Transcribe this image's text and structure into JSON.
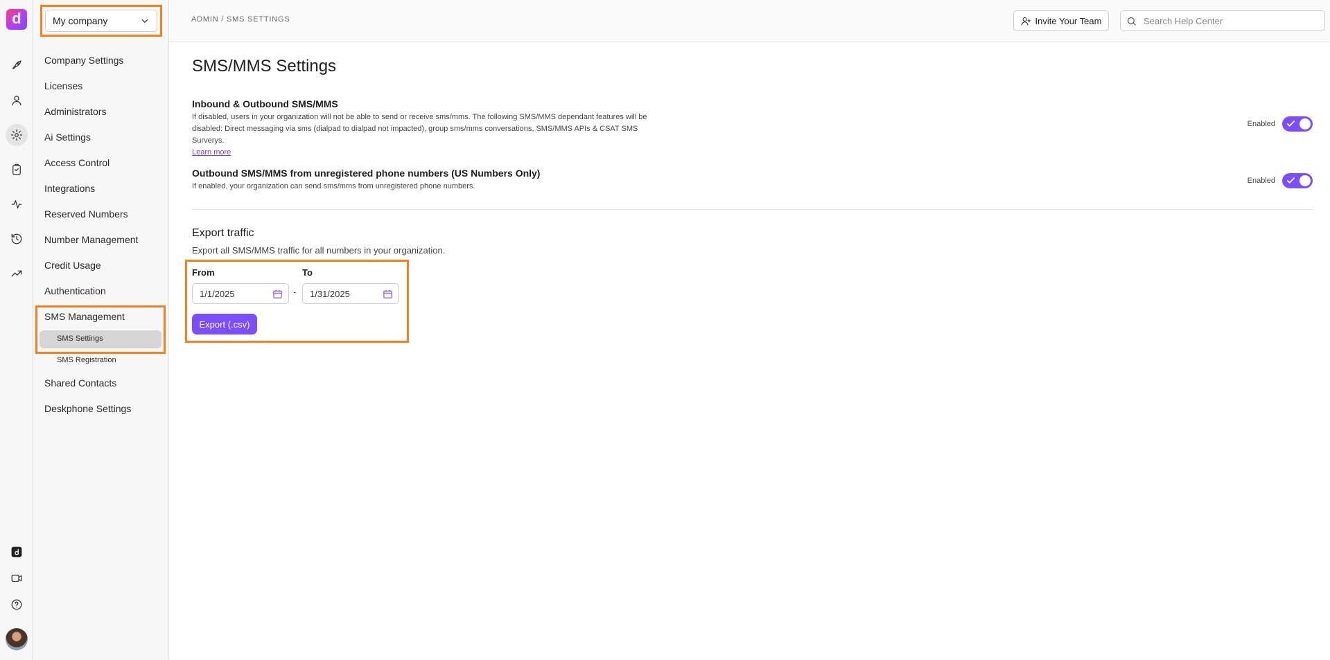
{
  "rail": {
    "logo_letter": "d",
    "icons": [
      "rocket-icon",
      "person-icon",
      "gear-icon",
      "clipboard-icon",
      "activity-icon",
      "history-icon",
      "trending-icon",
      "dialpad-app-icon",
      "video-icon",
      "help-icon"
    ]
  },
  "sidebar": {
    "company": "My company",
    "items": [
      {
        "label": "Company Settings"
      },
      {
        "label": "Licenses"
      },
      {
        "label": "Administrators"
      },
      {
        "label": "Ai Settings"
      },
      {
        "label": "Access Control"
      },
      {
        "label": "Integrations"
      },
      {
        "label": "Reserved Numbers"
      },
      {
        "label": "Number Management"
      },
      {
        "label": "Credit Usage"
      },
      {
        "label": "Authentication"
      },
      {
        "label": "SMS Management"
      }
    ],
    "sub_items": [
      {
        "label": "SMS Settings",
        "active": true
      },
      {
        "label": "SMS Registration",
        "active": false
      }
    ],
    "items_after": [
      {
        "label": "Shared Contacts"
      },
      {
        "label": "Deskphone Settings"
      }
    ]
  },
  "header": {
    "breadcrumb": "ADMIN / SMS SETTINGS",
    "invite_label": "Invite Your Team",
    "search_placeholder": "Search Help Center"
  },
  "main": {
    "title": "SMS/MMS Settings",
    "settings": [
      {
        "title": "Inbound & Outbound SMS/MMS",
        "desc": "If disabled, users in your organization will not be able to send or receive sms/mms. The following SMS/MMS dependant features will be disabled: Direct messaging via sms (dialpad to dialpad not impacted), group sms/mms conversations, SMS/MMS APIs & CSAT SMS Surverys.",
        "link": "Learn more",
        "status": "Enabled",
        "enabled": true
      },
      {
        "title": "Outbound SMS/MMS from unregistered phone numbers (US Numbers Only)",
        "desc": "If enabled, your organization can send sms/mms from unregistered phone numbers.",
        "status": "Enabled",
        "enabled": true
      }
    ],
    "export": {
      "title": "Export traffic",
      "desc": "Export all SMS/MMS traffic for all numbers in your organization.",
      "from_label": "From",
      "to_label": "To",
      "from_value": "1/1/2025",
      "to_value": "1/31/2025",
      "separator": "-",
      "button_label": "Export (.csv)"
    }
  },
  "colors": {
    "accent": "#7c4dff",
    "highlight": "#f5821f"
  }
}
